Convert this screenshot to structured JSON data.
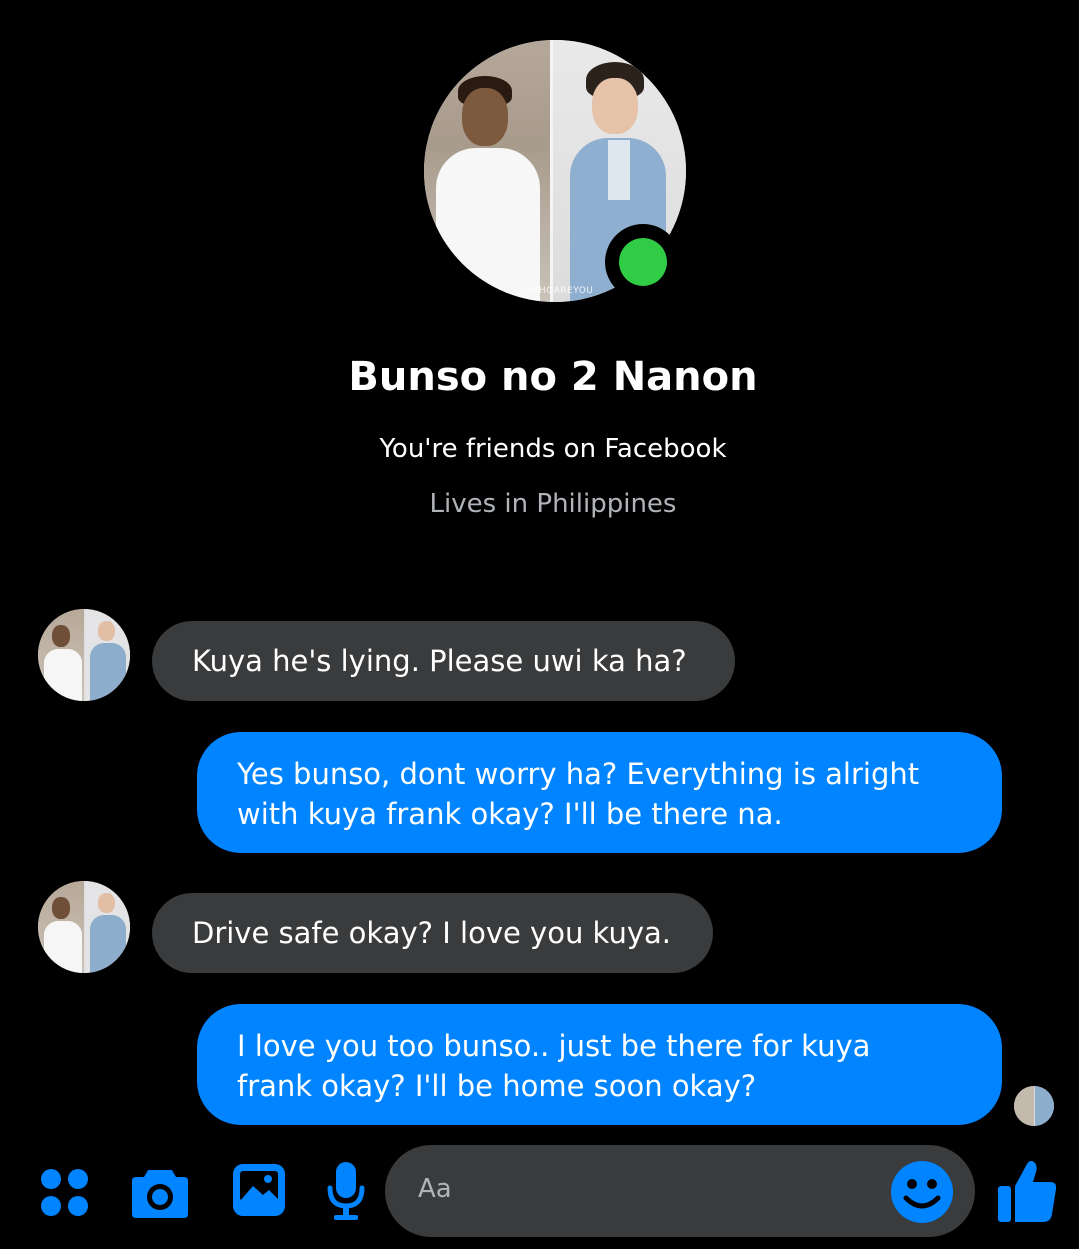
{
  "contact": {
    "name": "Bunso no 2 Nanon",
    "friendship": "You're friends on Facebook",
    "location": "Lives in Philippines",
    "photo_watermark": "@WHOAREYOU",
    "online": true,
    "online_color": "#31cc46"
  },
  "messages": [
    {
      "direction": "incoming",
      "text": "Kuya he's lying. Please uwi ka ha?"
    },
    {
      "direction": "outgoing",
      "lines": [
        "Yes bunso, dont worry ha? Everything is alright",
        "with kuya frank okay? I'll be there na."
      ]
    },
    {
      "direction": "incoming",
      "text": "Drive safe okay? I love you kuya."
    },
    {
      "direction": "outgoing",
      "lines": [
        "I love you too bunso.. just be there for kuya",
        "frank okay? I'll be home soon okay?"
      ]
    }
  ],
  "composer": {
    "placeholder": "Aa",
    "icons": [
      "apps-icon",
      "camera-icon",
      "gallery-icon",
      "microphone-icon",
      "emoji-icon",
      "like-icon"
    ]
  },
  "colors": {
    "background": "#000000",
    "incoming_bubble": "#3a3b3c",
    "outgoing_bubble": "#0084ff",
    "accent": "#0084ff",
    "secondary_text": "#b0b3b8"
  }
}
